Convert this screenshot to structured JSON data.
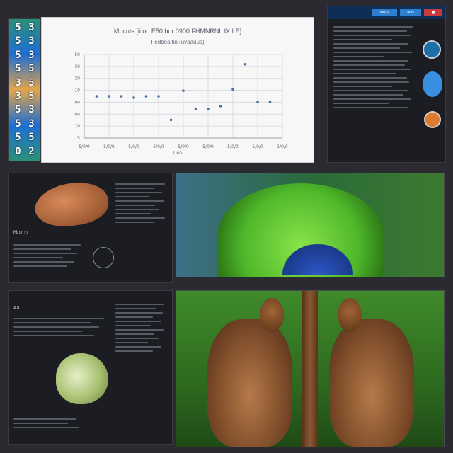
{
  "colors": {
    "background": "#2a2a30",
    "chart_bg": "#f7f7f8",
    "point": "#4a6fa5",
    "leaf_green": "#6fd13a",
    "dna_blue": "#2d58c8",
    "panel_dark": "#1c1d22",
    "root_brown": "#8a5a35",
    "accent_red": "#c93b3b",
    "accent_blue": "#2f7fd0"
  },
  "strip": {
    "glyphs": [
      "5",
      "3",
      "5",
      "3",
      "5",
      "3",
      "5",
      "5",
      "3",
      "5",
      "3",
      "5",
      "5",
      "3",
      "5",
      "3",
      "5",
      "5",
      "0",
      "2"
    ]
  },
  "chart_data": {
    "type": "scatter",
    "title": "Mbcnts [ii oo E50 bor 0900 FHMNRNL IX.LE]",
    "subtitle": "Fedbealtin (uvoauus)",
    "xlabel": "Lieo",
    "ylabel": "",
    "x_tick_labels": [
      "5/0/0",
      "5/0/0",
      "5/0/0",
      "5/0/0",
      "5/0/0",
      "5/0/0",
      "5/0/0",
      "5/0/0",
      "1/0/0"
    ],
    "y_tick_labels": [
      "50",
      "30",
      "20",
      "10",
      "00",
      "00",
      "10",
      "5"
    ],
    "x": [
      1,
      1.5,
      2,
      2.5,
      3,
      3.5,
      4,
      4.5,
      5,
      5.5,
      6,
      6.5,
      7,
      7.5,
      8
    ],
    "y": [
      3.0,
      3.0,
      3.0,
      2.9,
      3.0,
      3.0,
      1.3,
      3.4,
      2.1,
      2.1,
      2.3,
      3.5,
      5.3,
      2.6,
      2.6
    ],
    "xlim": [
      0.5,
      8.5
    ],
    "ylim": [
      0,
      6
    ],
    "grid": true
  },
  "right_panel": {
    "header_buttons": [
      {
        "label": "Mb/S",
        "color": "#2f7fd0"
      },
      {
        "label": "MIN",
        "color": "#2f7fd0"
      },
      {
        "label": "■",
        "color": "#c93b3b"
      }
    ],
    "icons": [
      "globe-icon",
      "circle-icon",
      "eye-icon"
    ]
  },
  "middle_left_panel": {
    "caption": "Mbcnts"
  },
  "bottom_left_panel": {
    "caption": "Aa"
  }
}
